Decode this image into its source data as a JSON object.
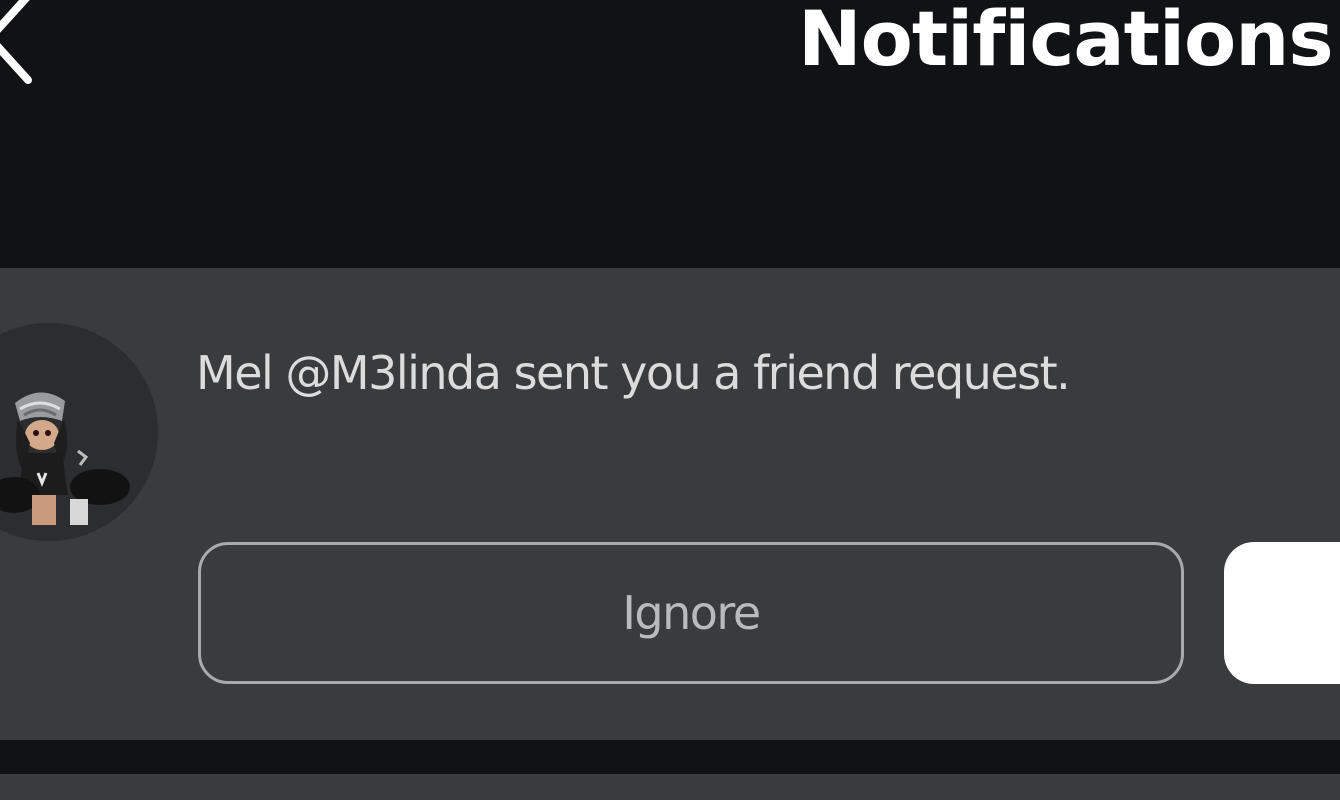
{
  "header": {
    "title": "Notifications",
    "back_icon": "chevron-left-icon"
  },
  "notifications": [
    {
      "avatar_icon": "avatar-image",
      "message": "Mel @M3linda sent you a friend request.",
      "actions": {
        "ignore_label": "Ignore"
      }
    }
  ],
  "colors": {
    "background": "#111214",
    "card": "#3a3b3d",
    "text_primary": "#ffffff",
    "text_secondary": "#dcdcdc",
    "button_outline": "#a9aaab",
    "accept_button": "#ffffff"
  }
}
